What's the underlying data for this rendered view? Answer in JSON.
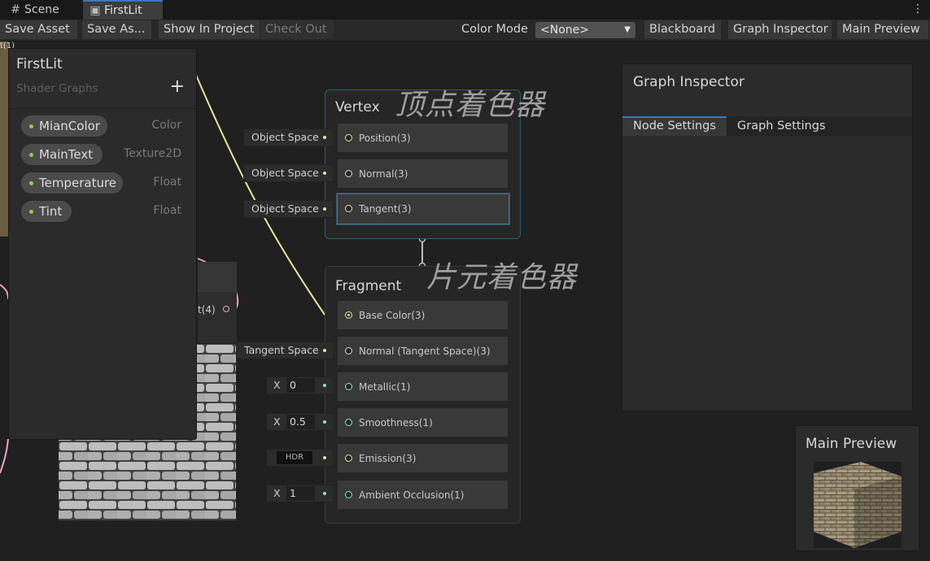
{
  "tabs": [
    {
      "label": "Scene",
      "icon": "grid-icon"
    },
    {
      "label": "FirstLit",
      "icon": "shader-graph-icon"
    }
  ],
  "toolbar": {
    "save_asset": "Save Asset",
    "save_as": "Save As...",
    "show_in_project": "Show In Project",
    "check_out": "Check Out",
    "color_mode_label": "Color Mode",
    "color_mode_value": "<None>",
    "blackboard": "Blackboard",
    "graph_inspector": "Graph Inspector",
    "main_preview": "Main Preview"
  },
  "blackboard": {
    "title": "FirstLit",
    "subtitle": "Shader Graphs",
    "add": "+",
    "properties": [
      {
        "name": "MianColor",
        "type": "Color"
      },
      {
        "name": "MainText",
        "type": "Texture2D"
      },
      {
        "name": "Temperature",
        "type": "Float"
      },
      {
        "name": "Tint",
        "type": "Float"
      }
    ]
  },
  "vertex": {
    "title": "Vertex",
    "annotation": "顶点着色器",
    "slots": [
      "Position(3)",
      "Normal(3)",
      "Tangent(3)"
    ],
    "inputs": [
      "Object Space",
      "Object Space",
      "Object Space"
    ]
  },
  "fragment": {
    "title": "Fragment",
    "annotation": "片元着色器",
    "slots": [
      "Base Color(3)",
      "Normal (Tangent Space)(3)",
      "Metallic(1)",
      "Smoothness(1)",
      "Emission(3)",
      "Ambient Occlusion(1)"
    ],
    "normal_input": "Tangent Space",
    "metallic": {
      "x": "X",
      "value": "0"
    },
    "smoothness": {
      "x": "X",
      "value": "0.5"
    },
    "emission": "HDR",
    "ao": {
      "x": "X",
      "value": "1"
    }
  },
  "hidden_node": {
    "output_label": "t(4)",
    "top_label": "t(1)"
  },
  "inspector": {
    "title": "Graph Inspector",
    "tabs": [
      "Node Settings",
      "Graph Settings"
    ]
  },
  "preview": {
    "title": "Main Preview"
  }
}
